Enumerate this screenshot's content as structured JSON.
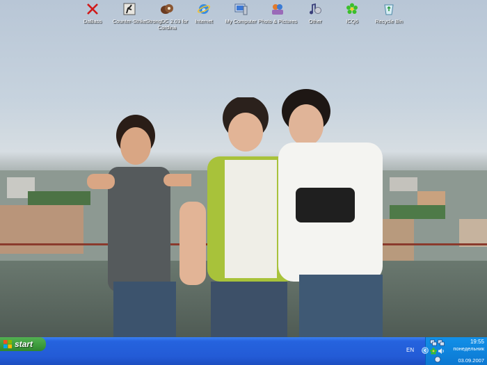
{
  "desktop": {
    "icons": [
      {
        "label": "DaBass",
        "icon": "red-x-icon"
      },
      {
        "label": "Counter-Strike",
        "icon": "counter-strike-icon"
      },
      {
        "label": "StrongDC 2.03 for Cordina",
        "icon": "strongdc-icon"
      },
      {
        "label": "Internet",
        "icon": "internet-explorer-icon"
      },
      {
        "label": "My Computer",
        "icon": "my-computer-icon"
      },
      {
        "label": "Photo & Pictures",
        "icon": "photos-icon"
      },
      {
        "label": "Other",
        "icon": "music-note-icon"
      },
      {
        "label": "ICQ6",
        "icon": "icq-flower-icon"
      },
      {
        "label": "Recycle Bin",
        "icon": "recycle-bin-icon"
      }
    ]
  },
  "taskbar": {
    "start_label": "start",
    "language": "EN",
    "clock_time": "19:55",
    "clock_day": "понедельник",
    "clock_date": "03.09.2007"
  },
  "colors": {
    "taskbar": "#235bd6",
    "start": "#3c9b3c",
    "tray": "#0c78d2"
  }
}
